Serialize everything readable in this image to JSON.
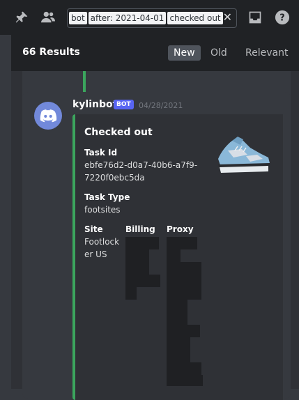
{
  "topbar": {
    "pin_icon": "pin-icon",
    "members_icon": "members-icon",
    "inbox_icon": "inbox-icon",
    "help_icon": "help-icon",
    "search": {
      "chips": [
        "bot",
        "after: 2021-04-01",
        "checked out"
      ],
      "clear_label": "✕"
    }
  },
  "results": {
    "count_label": "66 Results",
    "sort_options": [
      "New",
      "Old",
      "Relevant"
    ],
    "active_sort": "New"
  },
  "message": {
    "username": "kylinbot",
    "bot_tag": "BOT",
    "timestamp": "04/28/2021",
    "embed": {
      "title": "Checked out",
      "fields": {
        "task_id_name": "Task Id",
        "task_id_value_line1": "ebfe76d2-d0a7-40b6-a7f9-",
        "task_id_value_line2": "7220f0ebc5da",
        "task_type_name": "Task Type",
        "task_type_value": "footsites",
        "site_name": "Site",
        "site_value_line1": "Footlock",
        "site_value_line2": "er US",
        "billing_name": "Billing",
        "proxy_name": "Proxy"
      },
      "accent_color": "#3ba55d"
    }
  }
}
